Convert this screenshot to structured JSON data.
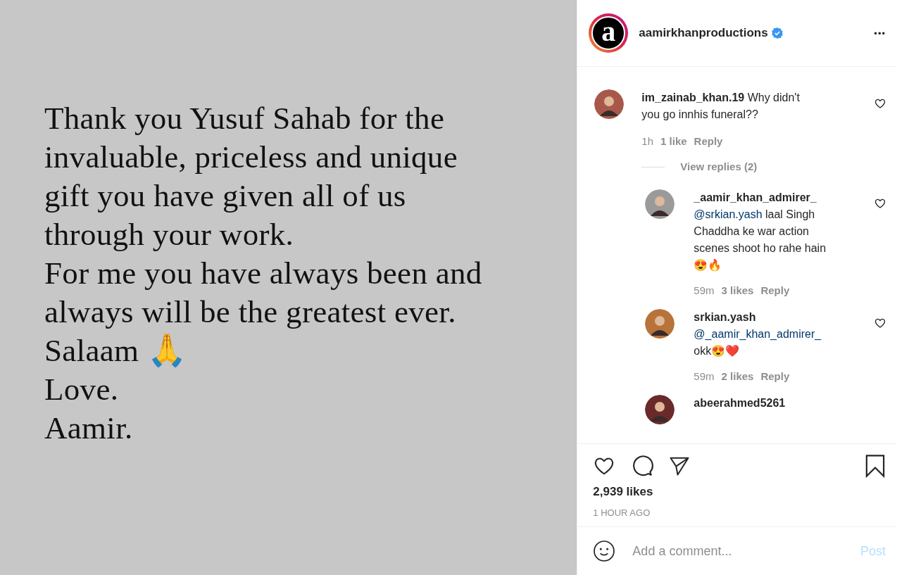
{
  "post": {
    "lines": [
      "Thank you Yusuf Sahab for the",
      "invaluable, priceless and unique",
      "gift you have given all of us",
      "through your work.",
      "For me you have always been and",
      "always will be the greatest ever.",
      "Salaam 🙏",
      "Love.",
      "Aamir."
    ]
  },
  "header": {
    "avatar_letter": "a",
    "username": "aamirkhanproductions",
    "verified": true,
    "more": "•••"
  },
  "comments": [
    {
      "username": "im_zainab_khan.19",
      "text": "Why didn't you go innhis funeral??",
      "time": "1h",
      "likes": "1 like",
      "reply": "Reply",
      "view_replies": "View replies (2)",
      "replies": [
        {
          "username": "_aamir_khan_admirer_",
          "mention": "@srkian.yash",
          "text": "laal Singh Chaddha ke war action scenes shoot ho rahe hain 😍🔥",
          "time": "59m",
          "likes": "3 likes",
          "reply": "Reply"
        },
        {
          "username": "srkian.yash",
          "mention": "@_aamir_khan_admirer_",
          "text": "okk😍❤️",
          "time": "59m",
          "likes": "2 likes",
          "reply": "Reply"
        },
        {
          "username": "abeerahmed5261"
        }
      ]
    }
  ],
  "likes": "2,939 likes",
  "time_ago": "1 HOUR AGO",
  "add_comment": {
    "placeholder": "Add a comment...",
    "post": "Post"
  }
}
